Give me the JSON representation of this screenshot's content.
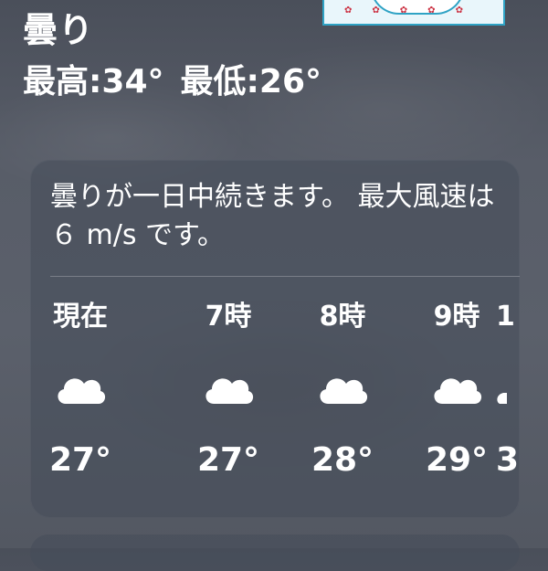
{
  "header": {
    "condition": "曇り",
    "high": "最高:34°",
    "low": "最低:26°"
  },
  "forecast_card": {
    "summary": "曇りが一日中続きます。 最大風速は６ m/s です。",
    "hours": [
      {
        "label": "現在",
        "icon": "cloud-icon",
        "temp": "27°"
      },
      {
        "label": "7時",
        "icon": "cloud-icon",
        "temp": "27°"
      },
      {
        "label": "8時",
        "icon": "cloud-icon",
        "temp": "28°"
      },
      {
        "label": "9時",
        "icon": "cloud-icon",
        "temp": "29°"
      },
      {
        "label": "1",
        "icon": "cloud-icon",
        "temp": "3"
      }
    ]
  },
  "colors": {
    "text": "#ffffff",
    "card_background": "#464c5a",
    "sky": "#585d68"
  }
}
